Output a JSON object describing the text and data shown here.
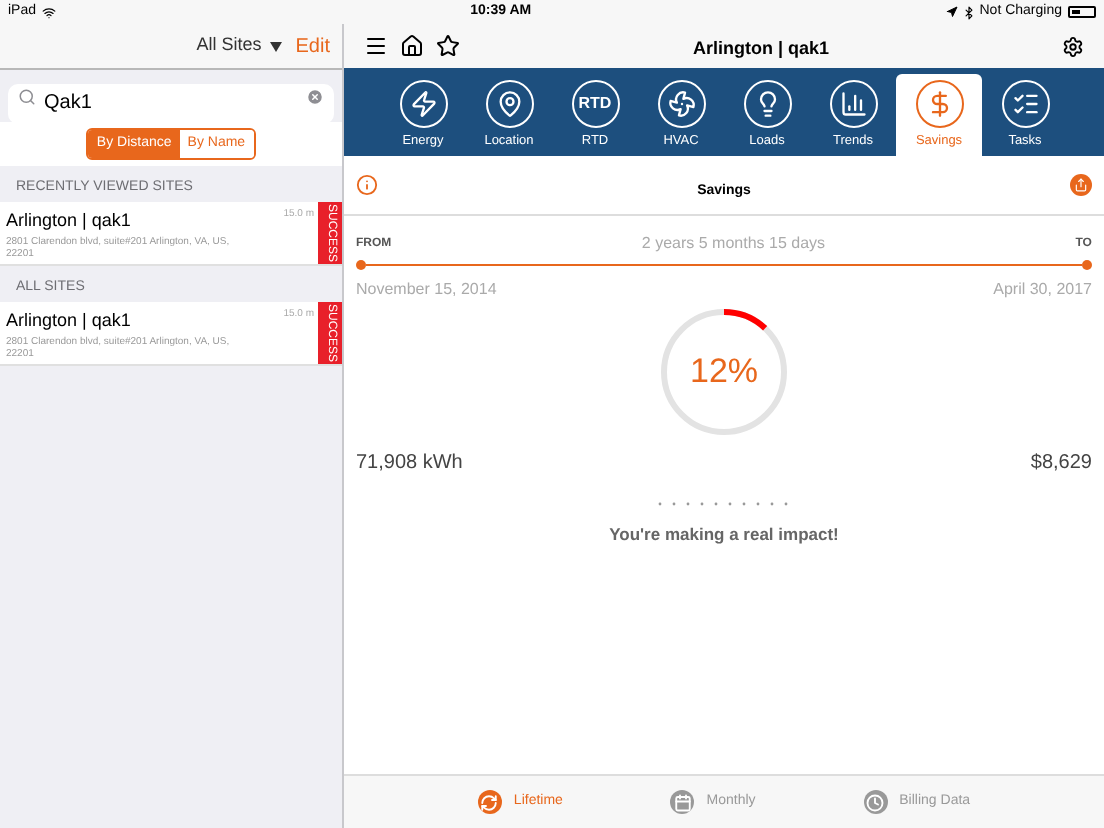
{
  "status_bar": {
    "device": "iPad",
    "time": "10:39 AM",
    "battery_text": "Not Charging"
  },
  "sidebar": {
    "site_filter": "All Sites",
    "edit": "Edit",
    "search": {
      "value": "Qak1"
    },
    "sort": [
      {
        "label": "By Distance",
        "selected": true
      },
      {
        "label": "By Name",
        "selected": false
      }
    ],
    "sections": [
      {
        "title": "RECENTLY VIEWED SITES",
        "sites": [
          {
            "name": "Arlington | qak1",
            "address": "2801 Clarendon blvd, suite#201 Arlington, VA, US, 22201",
            "distance": "15.0 m",
            "status": "SUCCESS"
          }
        ]
      },
      {
        "title": "ALL SITES",
        "sites": [
          {
            "name": "Arlington | qak1",
            "address": "2801 Clarendon blvd, suite#201 Arlington, VA, US, 22201",
            "distance": "15.0 m",
            "status": "SUCCESS"
          }
        ]
      }
    ]
  },
  "header": {
    "title": "Arlington | qak1"
  },
  "tabs": [
    {
      "kind": "energy",
      "label": "Energy",
      "selected": false
    },
    {
      "kind": "location",
      "label": "Location",
      "selected": false
    },
    {
      "kind": "rtd",
      "label": "RTD",
      "icon_text": "RTD",
      "selected": false
    },
    {
      "kind": "hvac",
      "label": "HVAC",
      "selected": false
    },
    {
      "kind": "loads",
      "label": "Loads",
      "selected": false
    },
    {
      "kind": "trends",
      "label": "Trends",
      "selected": false
    },
    {
      "kind": "savings",
      "label": "Savings",
      "selected": true
    },
    {
      "kind": "tasks",
      "label": "Tasks",
      "selected": false
    }
  ],
  "savings": {
    "title": "Savings",
    "from_label": "FROM",
    "to_label": "TO",
    "duration": "2 years 5 months 15 days",
    "from_date": "November 15, 2014",
    "to_date": "April 30, 2017",
    "percent": "12%",
    "level": 0.12,
    "energy": "71,908 kWh",
    "money": "$8,629",
    "message": "You're making a real impact!"
  },
  "bottom_tabs": [
    {
      "kind": "lifetime",
      "label": "Lifetime",
      "selected": true
    },
    {
      "kind": "monthly",
      "label": "Monthly",
      "selected": false
    },
    {
      "kind": "billing",
      "label": "Billing Data",
      "selected": false
    }
  ]
}
